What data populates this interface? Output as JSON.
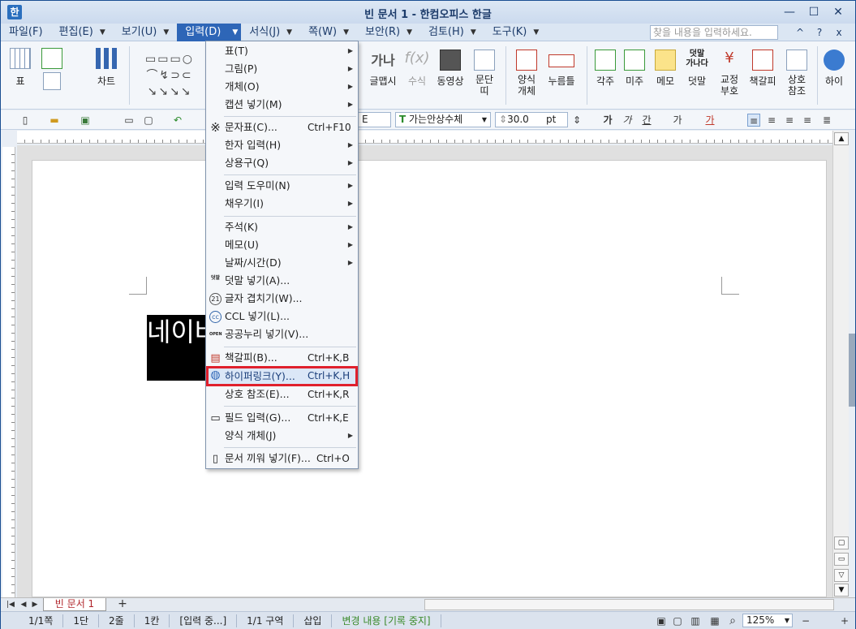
{
  "window": {
    "title": "빈 문서 1 - 한컴오피스 한글",
    "app_icon_glyph": "한",
    "min_glyph": "—",
    "max_glyph": "☐",
    "close_glyph": "✕"
  },
  "menubar": {
    "items": [
      {
        "label": "파일(F)"
      },
      {
        "label": "편집(E)"
      },
      {
        "label": "보기(U)"
      },
      {
        "label": "입력(D)"
      },
      {
        "label": "서식(J)"
      },
      {
        "label": "쪽(W)"
      },
      {
        "label": "보안(R)"
      },
      {
        "label": "검토(H)"
      },
      {
        "label": "도구(K)"
      }
    ],
    "search_placeholder": "찾을 내용을 입력하세요.",
    "right_icons": [
      "^",
      "?",
      "x"
    ]
  },
  "ribbon": {
    "buttons": [
      {
        "label": "표"
      },
      {
        "label": "차트"
      },
      {
        "label": "글맵시"
      },
      {
        "label": "수식"
      },
      {
        "label": "동영상"
      },
      {
        "label": "문단 띠"
      },
      {
        "label": "양식 개체"
      },
      {
        "label": "누름틀"
      },
      {
        "label": "각주"
      },
      {
        "label": "미주"
      },
      {
        "label": "메모"
      },
      {
        "label": "덧말"
      },
      {
        "label": "교정 부호"
      },
      {
        "label": "책갈피"
      },
      {
        "label": "상호 참조"
      },
      {
        "label": "하이"
      }
    ]
  },
  "format_bar": {
    "font": "가는안상수체",
    "size": "30.0",
    "unit": "pt"
  },
  "document": {
    "text": "네이버"
  },
  "dropdown": {
    "items": [
      {
        "label": "표(T)",
        "shortcut": "",
        "submenu": true
      },
      {
        "label": "그림(P)",
        "shortcut": "",
        "submenu": true
      },
      {
        "label": "개체(O)",
        "shortcut": "",
        "submenu": true
      },
      {
        "label": "캡션 넣기(M)",
        "shortcut": "",
        "submenu": true
      },
      {
        "label": "문자표(C)...",
        "shortcut": "Ctrl+F10",
        "submenu": false
      },
      {
        "label": "한자 입력(H)",
        "shortcut": "",
        "submenu": true
      },
      {
        "label": "상용구(Q)",
        "shortcut": "",
        "submenu": true
      },
      {
        "label": "입력 도우미(N)",
        "shortcut": "",
        "submenu": true
      },
      {
        "label": "채우기(I)",
        "shortcut": "",
        "submenu": true
      },
      {
        "label": "주석(K)",
        "shortcut": "",
        "submenu": true
      },
      {
        "label": "메모(U)",
        "shortcut": "",
        "submenu": true
      },
      {
        "label": "날짜/시간(D)",
        "shortcut": "",
        "submenu": true
      },
      {
        "label": "덧말 넣기(A)...",
        "shortcut": "",
        "submenu": false
      },
      {
        "label": "글자 겹치기(W)...",
        "shortcut": "",
        "submenu": false
      },
      {
        "label": "CCL 넣기(L)...",
        "shortcut": "",
        "submenu": false
      },
      {
        "label": "공공누리 넣기(V)...",
        "shortcut": "",
        "submenu": false
      },
      {
        "label": "책갈피(B)...",
        "shortcut": "Ctrl+K,B",
        "submenu": false
      },
      {
        "label": "하이퍼링크(Y)...",
        "shortcut": "Ctrl+K,H",
        "submenu": false
      },
      {
        "label": "상호 참조(E)...",
        "shortcut": "Ctrl+K,R",
        "submenu": false
      },
      {
        "label": "필드 입력(G)...",
        "shortcut": "Ctrl+K,E",
        "submenu": false
      },
      {
        "label": "양식 개체(J)",
        "shortcut": "",
        "submenu": true
      },
      {
        "label": "문서 끼워 넣기(F)...",
        "shortcut": "Ctrl+O",
        "submenu": false
      }
    ],
    "icons": {
      "char_map": "※",
      "dotmal": "덧말",
      "overlap": "21",
      "ccl": "cc",
      "kogl": "OPEN",
      "bookmark": "▤",
      "hyperlink": "◍",
      "field": "▭",
      "insert_doc": "▯"
    }
  },
  "tabs": {
    "doc_tab": "빈 문서 1",
    "add_tab": "+"
  },
  "statusbar": {
    "page": "1/1쪽",
    "column": "1단",
    "line": "2줄",
    "cell": "1칸",
    "mode": "[입력 중...]",
    "section": "1/1 구역",
    "insert": "삽입",
    "track": "변경 내용 [기록 중지]",
    "zoom": "125%"
  },
  "colors": {
    "accent": "#2e66b7",
    "highlight_border": "#e0202c"
  }
}
